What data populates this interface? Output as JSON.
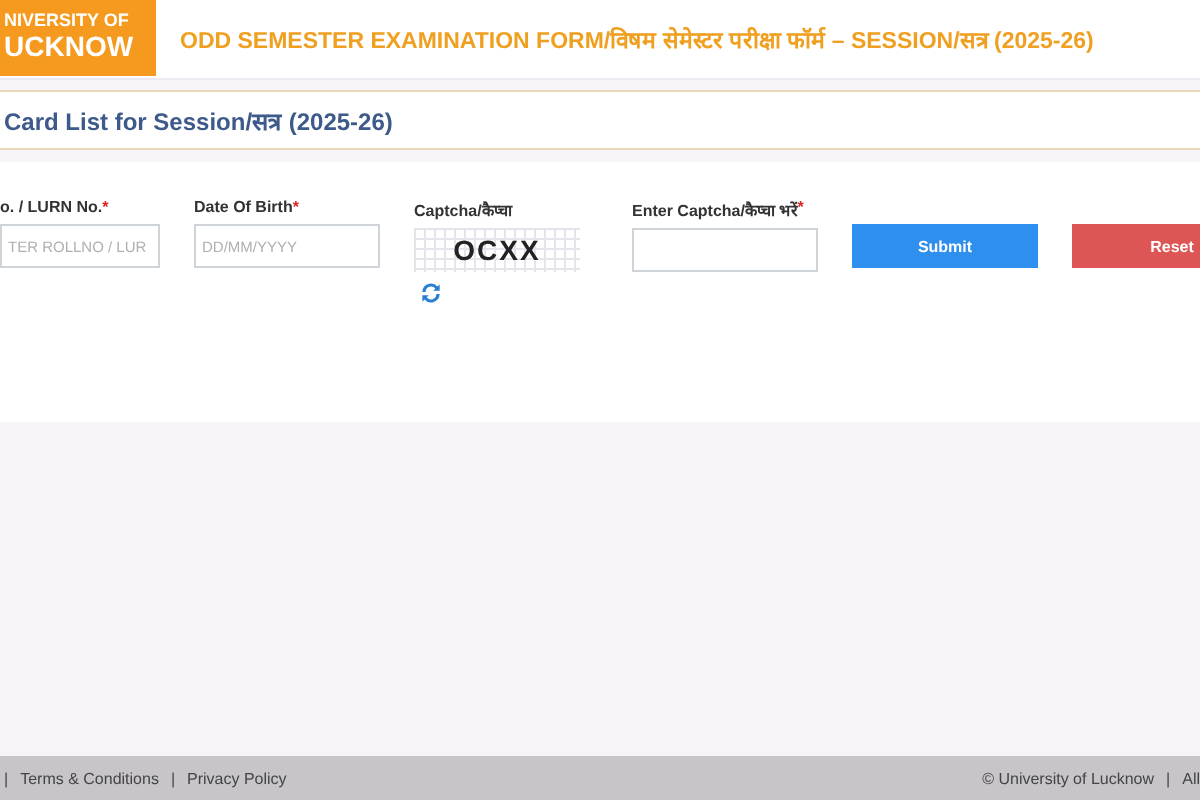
{
  "header": {
    "logo_lines": [
      "NIVERSITY OF",
      "UCKNOW"
    ],
    "title": "ODD SEMESTER EXAMINATION FORM/विषम सेमेस्टर परीक्षा फॉर्म – SESSION/सत्र (2025-26)"
  },
  "panel": {
    "title": "Card List for Session/सत्र (2025-26)"
  },
  "form": {
    "fields": [
      {
        "kind": "input",
        "label": "o. / LURN No.",
        "mark": "*",
        "placeholder": "TER ROLLNO / LUR"
      },
      {
        "kind": "input",
        "label": "Date Of Birth",
        "mark": "*",
        "placeholder": "DD/MM/YYYY"
      },
      {
        "kind": "captcha",
        "label": "Captcha/कैप्चा",
        "code": "OCXX"
      },
      {
        "kind": "input",
        "label": "Enter Captcha/कैप्चा भरें",
        "mark": "*"
      }
    ],
    "buttons": [
      {
        "label": "Submit",
        "kind": "primary"
      },
      {
        "label": "Reset",
        "kind": "danger"
      }
    ]
  },
  "footer": {
    "separator": "|",
    "left_links": [
      "Terms & Conditions",
      "Privacy Policy"
    ],
    "right_text": "© University of Lucknow",
    "right_cut": "All"
  }
}
